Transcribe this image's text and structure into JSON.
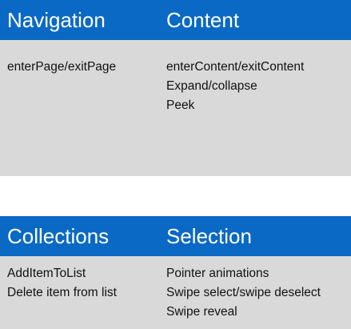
{
  "colors": {
    "header_band": "#0a69c4",
    "panel_background": "#d9d9d9",
    "header_text": "#ffffff",
    "body_text": "#111111"
  },
  "top_section": {
    "left_heading": "Navigation",
    "right_heading": "Content",
    "left_items": [
      "enterPage/exitPage"
    ],
    "right_items": [
      "enterContent/exitContent",
      "Expand/collapse",
      "Peek"
    ]
  },
  "bottom_section": {
    "left_heading": "Collections",
    "right_heading": "Selection",
    "left_items": [
      "AddItemToList",
      "Delete item from list"
    ],
    "right_items": [
      "Pointer animations",
      "Swipe select/swipe deselect",
      "Swipe reveal"
    ]
  }
}
